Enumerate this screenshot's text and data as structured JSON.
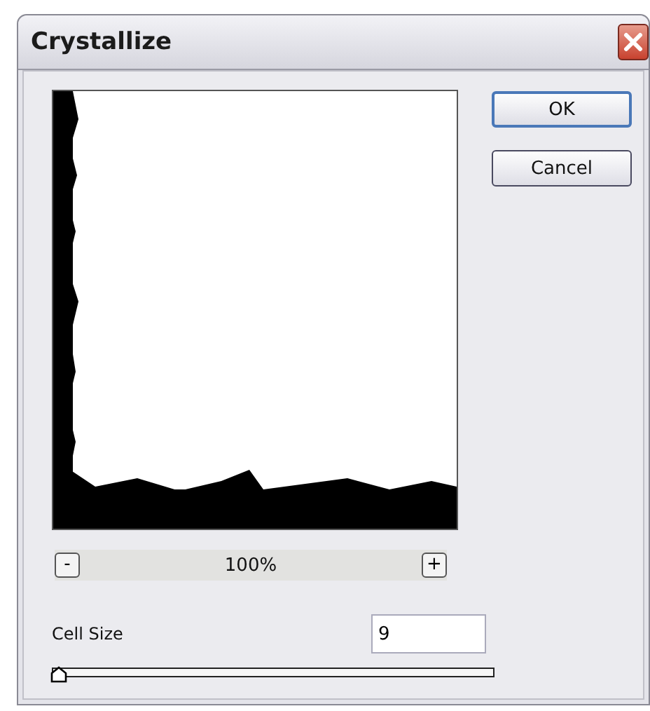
{
  "window": {
    "title": "Crystallize"
  },
  "buttons": [
    {
      "label": "OK",
      "default": true
    },
    {
      "label": "Cancel",
      "default": false
    }
  ],
  "zoom": {
    "minus": "-",
    "level_text": "100%",
    "plus": "+"
  },
  "cell_size": {
    "label": "Cell Size",
    "value": "9",
    "level": 0
  }
}
